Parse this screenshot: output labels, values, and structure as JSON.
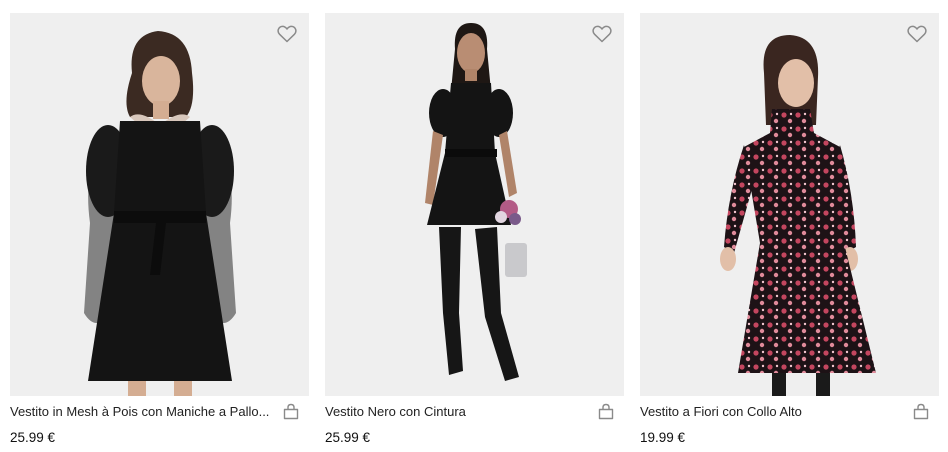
{
  "products": [
    {
      "name": "Vestito in Mesh à Pois con Maniche a Palloncino",
      "display_name": "Vestito in Mesh à Pois con Maniche a Pallo...",
      "price": "25.99 €",
      "wishlist_icon": "heart-outline-icon",
      "cart_icon": "shopping-bag-icon",
      "image_desc": "model-black-dress-polka-mesh"
    },
    {
      "name": "Vestito Nero con Cintura",
      "display_name": "Vestito Nero con Cintura",
      "price": "25.99 €",
      "wishlist_icon": "heart-outline-icon",
      "cart_icon": "shopping-bag-icon",
      "image_desc": "model-black-belted-dress-boots"
    },
    {
      "name": "Vestito a Fiori con Collo Alto",
      "display_name": "Vestito a Fiori con Collo Alto",
      "price": "19.99 €",
      "wishlist_icon": "heart-outline-icon",
      "cart_icon": "shopping-bag-icon",
      "image_desc": "model-floral-highneck-dress"
    }
  ],
  "colors": {
    "image_bg": "#efefef",
    "icon": "#8a8a8a",
    "text": "#222222"
  }
}
